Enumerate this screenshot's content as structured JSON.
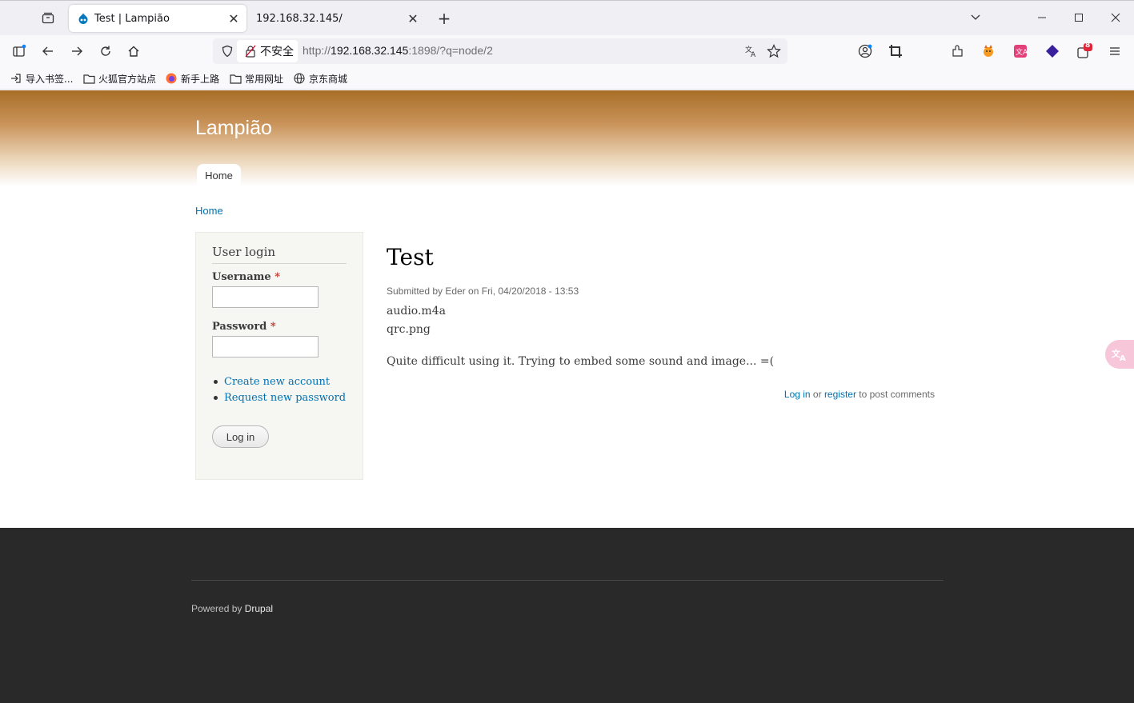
{
  "browser": {
    "tabs": [
      {
        "title": "Test | Lampião",
        "active": true
      },
      {
        "title": "192.168.32.145/",
        "active": false
      }
    ],
    "url": {
      "insecure_label": "不安全",
      "scheme": "http://",
      "host": "192.168.32.145",
      "rest": ":1898/?q=node/2"
    },
    "bookmarks": [
      {
        "label": "导入书签...",
        "icon": "import-icon"
      },
      {
        "label": "火狐官方站点",
        "icon": "folder-icon"
      },
      {
        "label": "新手上路",
        "icon": "firefox-icon"
      },
      {
        "label": "常用网址",
        "icon": "folder-icon"
      },
      {
        "label": "京东商城",
        "icon": "globe-icon"
      }
    ],
    "extension_badge": "8"
  },
  "site": {
    "name": "Lampião",
    "menu": [
      "Home"
    ],
    "breadcrumb": "Home"
  },
  "login_block": {
    "title": "User login",
    "username_label": "Username",
    "password_label": "Password",
    "required_marker": "*",
    "links": [
      "Create new account",
      "Request new password"
    ],
    "submit": "Log in"
  },
  "node": {
    "title": "Test",
    "submitted": "Submitted by Eder on Fri, 04/20/2018 - 13:53",
    "files": [
      "audio.m4a",
      "qrc.png"
    ],
    "body": "Quite difficult using it. Trying to embed some sound and image... =(",
    "comment_login": "Log in",
    "comment_or": " or ",
    "comment_register": "register",
    "comment_suffix": " to post comments"
  },
  "footer": {
    "powered_by": "Powered by ",
    "drupal": "Drupal"
  },
  "colors": {
    "link": "#0071b3",
    "header_top": "#a86e27",
    "footer_bg": "#292929"
  }
}
